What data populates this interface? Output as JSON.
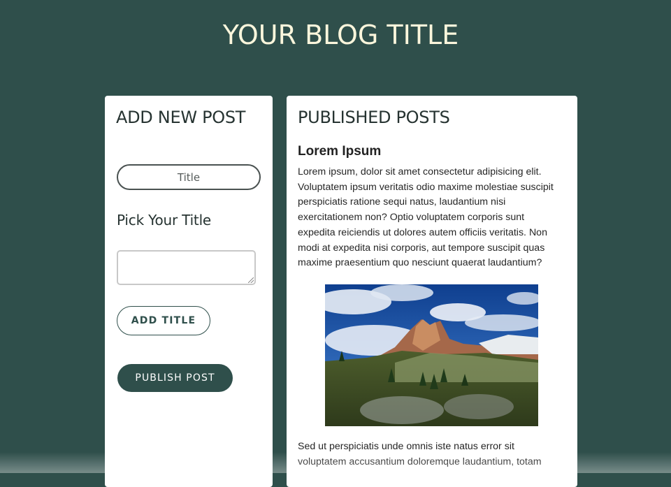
{
  "header": {
    "blog_title": "YOUR BLOG TITLE"
  },
  "add_post": {
    "heading": "ADD NEW POST",
    "title_pill": "Title",
    "pick_label": "Pick Your Title",
    "textarea_value": "",
    "add_title_button": "ADD TITLE",
    "publish_button": "PUBLISH POST"
  },
  "published": {
    "heading": "PUBLISHED POSTS",
    "posts": [
      {
        "title": "Lorem Ipsum",
        "body": "Lorem ipsum, dolor sit amet consectetur adipisicing elit. Voluptatem ipsum veritatis odio maxime molestiae suscipit perspiciatis ratione sequi natus, laudantium nisi exercitationem non? Optio voluptatem corporis sunt expedita reiciendis ut dolores autem officiis veritatis. Non modi at expedita nisi corporis, aut tempore suscipit quas maxime praesentium quo nesciunt quaerat laudantium?",
        "image": "mountain-landscape-photo",
        "body_2": "Sed ut perspiciatis unde omnis iste natus error sit voluptatem accusantium doloremque laudantium, totam"
      }
    ]
  },
  "colors": {
    "background": "#2f4f4b",
    "title_text": "#fbf6dc",
    "card": "#ffffff",
    "accent": "#2f4f4b"
  }
}
